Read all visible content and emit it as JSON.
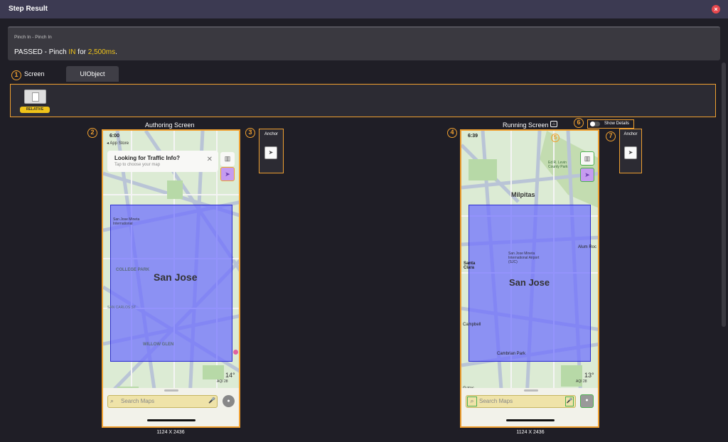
{
  "window": {
    "title": "Step Result",
    "close_icon": "close-icon"
  },
  "summary": {
    "subtitle": "Pinch In - Pinch In",
    "result_prefix": "PASSED - Pinch ",
    "result_direction": "IN",
    "result_mid": " for ",
    "result_duration": "2,500ms",
    "result_suffix": "."
  },
  "markers": [
    "1",
    "2",
    "3",
    "4",
    "5",
    "6",
    "7"
  ],
  "tabs": {
    "screen": "Screen",
    "uiobject": "UIObject"
  },
  "toolbar": {
    "badge": "RELATIVE"
  },
  "authoring": {
    "label": "Authoring Screen",
    "time": "6:00",
    "back": "◂ App Store",
    "card_title": "Looking for Traffic Info?",
    "card_sub": "Tap to choose your map",
    "city": "San Jose",
    "places": [
      "COLLEGE PARK",
      "WILLOW GLEN",
      "SAN CARLOS ST"
    ],
    "airport": "San Jose Mineta International",
    "weather_temp": "14°",
    "weather_aqi": "AQI 28",
    "search_placeholder": "Search Maps",
    "dims": "1124 X 2436"
  },
  "running": {
    "label": "Running Screen",
    "time": "6:39",
    "city": "San Jose",
    "places": [
      "Milpitas",
      "Santa Clara",
      "Campbell",
      "Cambrian Park",
      "Alum Roc",
      "Ed R. Levin County Park",
      "Gatos"
    ],
    "airport": "San Jose Mineta International Airport (SJC)",
    "weather_temp": "13°",
    "weather_aqi": "AQI 28",
    "search_placeholder": "Search Maps",
    "dims": "1124 X 2436"
  },
  "anchor": {
    "title": "Anchor"
  },
  "show_details": "Show Details",
  "colors": {
    "accent": "#f0a030",
    "yellow": "#f0c419",
    "selection": "#6e6eff"
  }
}
